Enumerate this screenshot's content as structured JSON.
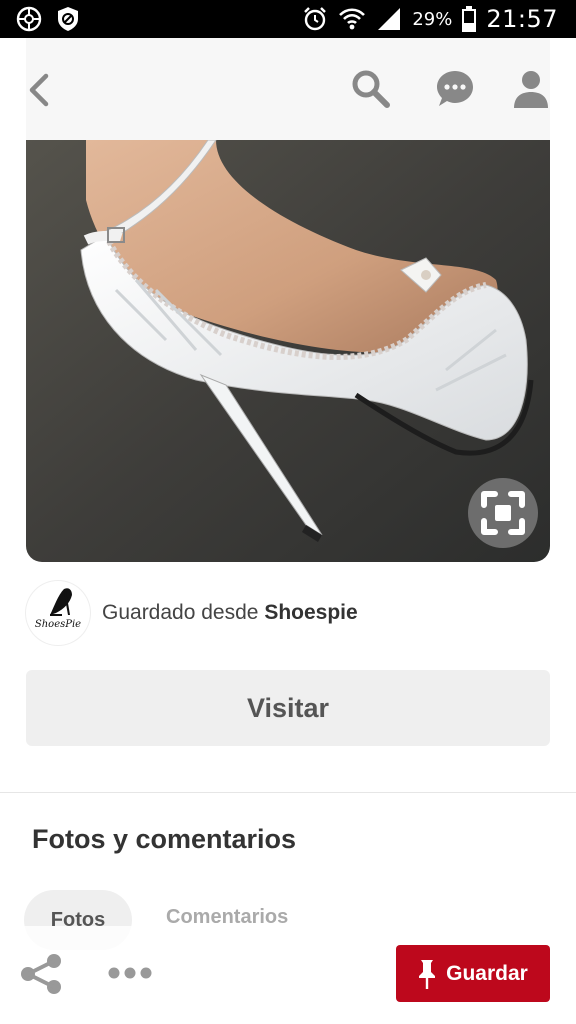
{
  "status_bar": {
    "battery_percent": "29%",
    "time": "21:57"
  },
  "top_bar": {
    "icons": [
      "chevron-left-icon",
      "search-icon",
      "chat-bubble-icon",
      "profile-icon"
    ]
  },
  "pin": {
    "image_description_icon": "shoe-image",
    "zoom_icon": "visual-search-icon"
  },
  "source": {
    "prefix": "Guardado desde",
    "name": "Shoespie",
    "logo_text": "ShoesPie"
  },
  "visit_button": {
    "label": "Visitar"
  },
  "section": {
    "title": "Fotos y comentarios",
    "tabs": [
      {
        "label": "Fotos",
        "selected": true
      },
      {
        "label": "Comentarios",
        "selected": false
      }
    ]
  },
  "bottom_bar": {
    "save_label": "Guardar"
  },
  "colors": {
    "accent": "#bd081c",
    "status_bar_bg": "#000000"
  }
}
